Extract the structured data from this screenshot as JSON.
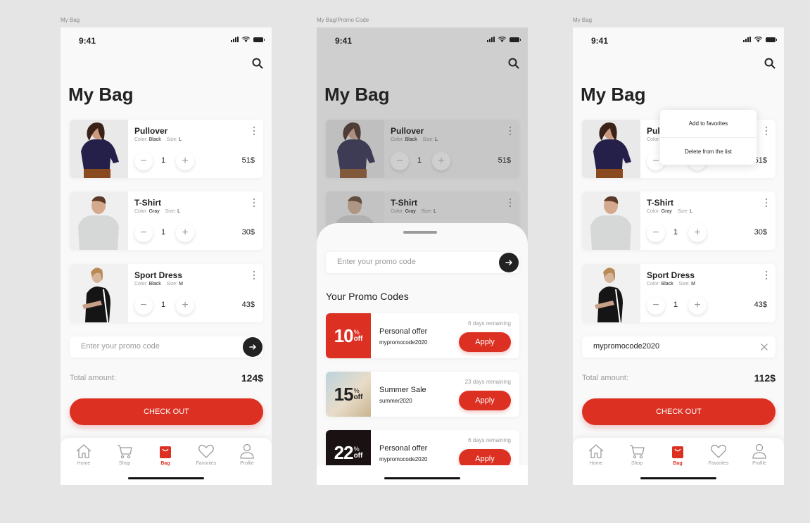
{
  "status": {
    "time": "9:41"
  },
  "frames": [
    {
      "label": "My Bag"
    },
    {
      "label": "My Bag/Promo Code"
    },
    {
      "label": "My Bag"
    }
  ],
  "bag": {
    "title": "My Bag",
    "color_label": "Color:",
    "size_label": "Size:",
    "items": [
      {
        "name": "Pullover",
        "color": "Black",
        "size": "L",
        "qty": "1",
        "price": "51$"
      },
      {
        "name": "T-Shirt",
        "color": "Gray",
        "size": "L",
        "qty": "1",
        "price": "30$"
      },
      {
        "name": "Sport Dress",
        "color": "Black",
        "size": "M",
        "qty": "1",
        "price": "43$"
      }
    ],
    "promo_placeholder": "Enter your promo code",
    "promo_applied": "mypromocode2020",
    "total_label": "Total amount:",
    "total_value": "124$",
    "total_value_discounted": "112$",
    "checkout_label": "CHECK OUT"
  },
  "promo_sheet": {
    "title": "Your Promo Codes",
    "codes": [
      {
        "percent": "10",
        "pct_sign": "%",
        "off": "off",
        "title": "Personal offer",
        "code": "mypromocode2020",
        "remaining": "6 days remaining",
        "apply": "Apply"
      },
      {
        "percent": "15",
        "pct_sign": "%",
        "off": "off",
        "title": "Summer Sale",
        "code": "summer2020",
        "remaining": "23 days remaining",
        "apply": "Apply"
      },
      {
        "percent": "22",
        "pct_sign": "%",
        "off": "off",
        "title": "Personal offer",
        "code": "mypromocode2020",
        "remaining": "6 days remaining",
        "apply": "Apply"
      }
    ]
  },
  "context_menu": {
    "add_favorites": "Add to favorites",
    "delete": "Delete from the list"
  },
  "tabs": [
    {
      "label": "Home",
      "icon": "home-icon"
    },
    {
      "label": "Shop",
      "icon": "cart-icon"
    },
    {
      "label": "Bag",
      "icon": "bag-icon",
      "active": true
    },
    {
      "label": "Favorites",
      "icon": "heart-icon"
    },
    {
      "label": "Profile",
      "icon": "profile-icon"
    }
  ],
  "colors": {
    "accent": "#db3022",
    "background": "#f9f9f9",
    "text": "#222222",
    "muted": "#9b9b9b"
  }
}
